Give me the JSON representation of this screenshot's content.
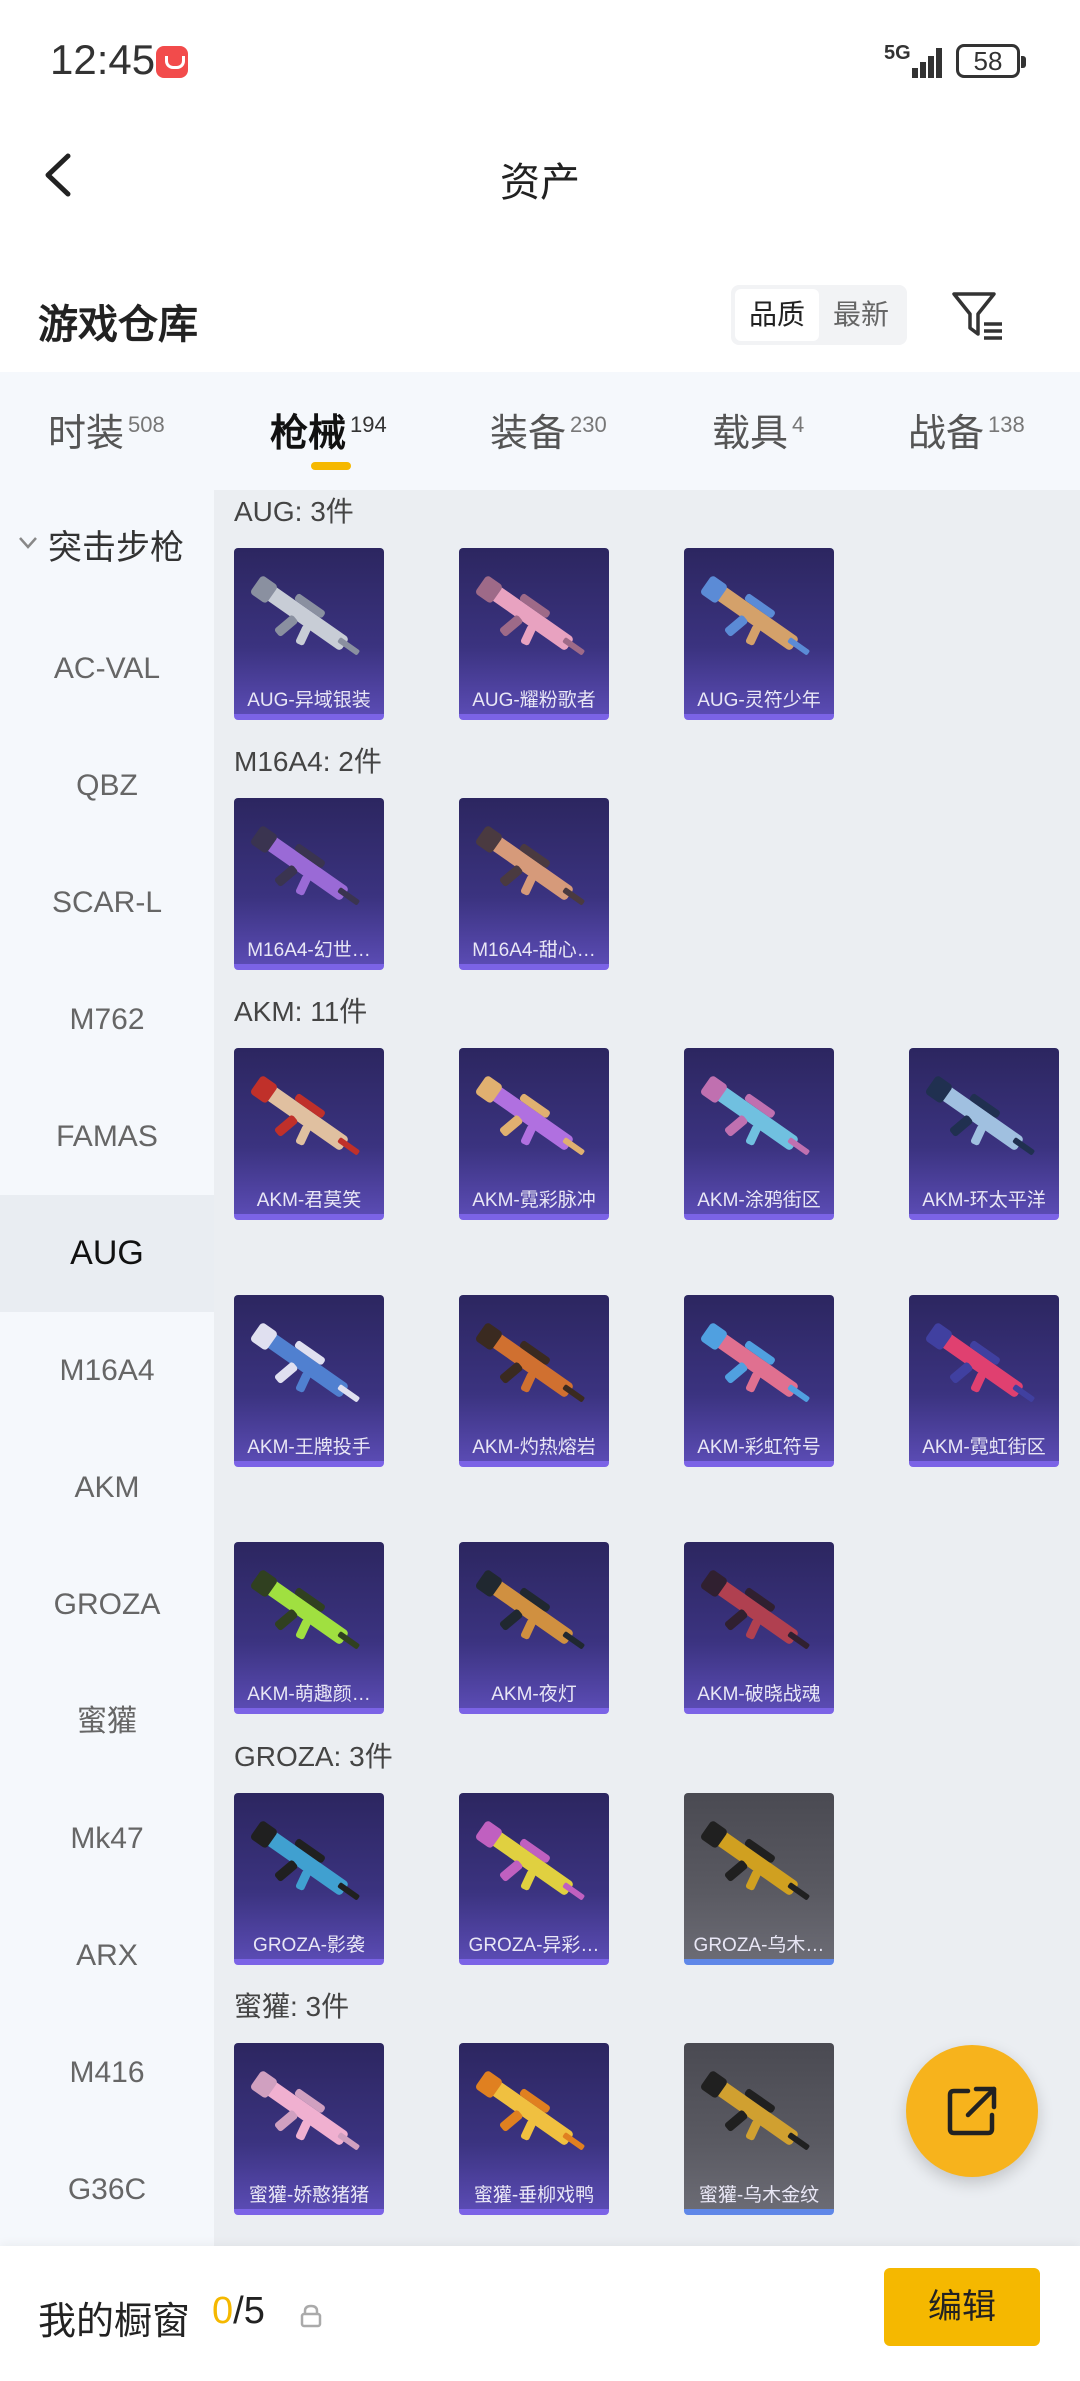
{
  "status_bar": {
    "time": "12:45",
    "network": "5G",
    "battery": "58"
  },
  "header": {
    "title": "资产"
  },
  "section": {
    "title": "游戏仓库",
    "sort_options": [
      "品质",
      "最新"
    ],
    "active_sort": "品质"
  },
  "tabs": [
    {
      "label": "时装",
      "count": "508"
    },
    {
      "label": "枪械",
      "count": "194"
    },
    {
      "label": "装备",
      "count": "230"
    },
    {
      "label": "载具",
      "count": "4"
    },
    {
      "label": "战备",
      "count": "138"
    }
  ],
  "sidebar": {
    "group": "突击步枪",
    "items": [
      "AC-VAL",
      "QBZ",
      "SCAR-L",
      "M762",
      "FAMAS",
      "AUG",
      "M16A4",
      "AKM",
      "GROZA",
      "蜜獾",
      "Mk47",
      "ARX",
      "M416",
      "G36C"
    ],
    "active": "AUG"
  },
  "groups": [
    {
      "title": "AUG: 3件",
      "items": [
        "AUG-异域银装",
        "AUG-耀粉歌者",
        "AUG-灵符少年"
      ]
    },
    {
      "title": "M16A4: 2件",
      "items": [
        "M16A4-幻世…",
        "M16A4-甜心…"
      ]
    },
    {
      "title": "AKM: 11件",
      "items": [
        "AKM-君莫笑",
        "AKM-霓彩脉冲",
        "AKM-涂鸦街区",
        "AKM-环太平洋",
        "AKM-王牌投手",
        "AKM-灼热熔岩",
        "AKM-彩虹符号",
        "AKM-霓虹街区",
        "AKM-萌趣颜…",
        "AKM-夜灯",
        "AKM-破晓战魂"
      ]
    },
    {
      "title": "GROZA: 3件",
      "items": [
        "GROZA-影袭",
        "GROZA-异彩…",
        "GROZA-乌木…"
      ]
    },
    {
      "title": "蜜獾: 3件",
      "items": [
        "蜜獾-娇憨猪猪",
        "蜜獾-垂柳戏鸭",
        "蜜獾-乌木金纹"
      ]
    }
  ],
  "colors": {
    "accent": "#f5b800",
    "card_purple": "#3b3380",
    "card_gray": "#5a5a62"
  },
  "bottom_bar": {
    "label": "我的橱窗",
    "count_current": "0",
    "count_total": "/5",
    "edit_label": "编辑"
  }
}
